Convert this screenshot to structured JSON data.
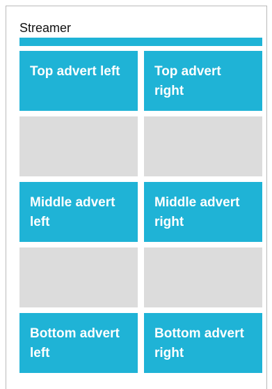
{
  "streamer": {
    "label": "Streamer"
  },
  "adverts": {
    "top_left": "Top advert left",
    "top_right": "Top advert right",
    "middle_left": "Middle advert left",
    "middle_right": "Middle advert right",
    "bottom_left": "Bottom advert left",
    "bottom_right": "Bottom advert right"
  },
  "colors": {
    "advert_blue": "#1fb3d6",
    "placeholder_grey": "#dcdcdc",
    "frame_border": "#b9b9b9"
  }
}
